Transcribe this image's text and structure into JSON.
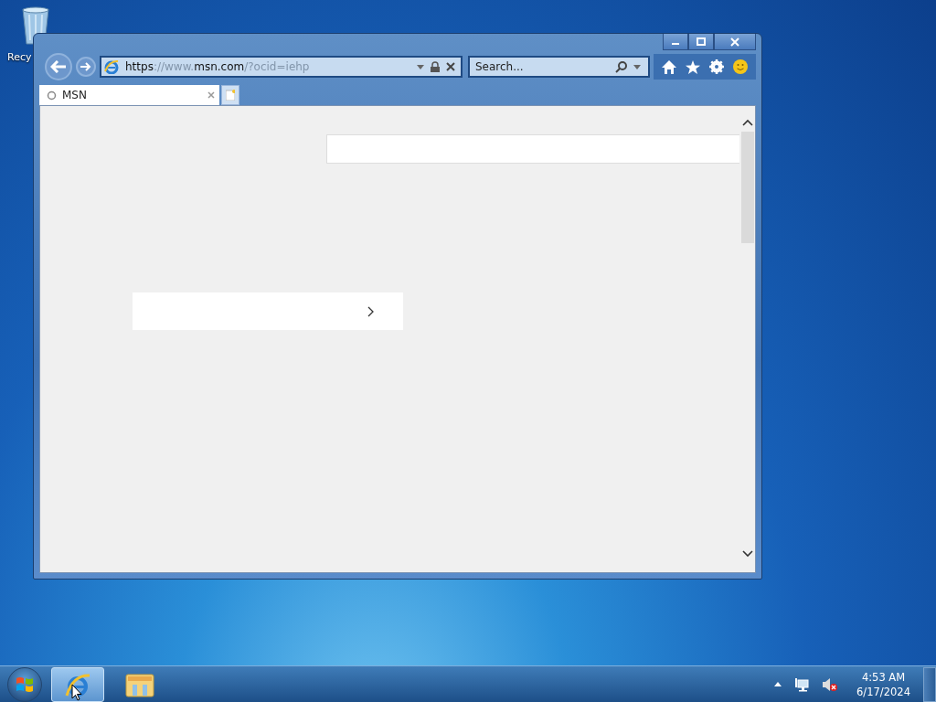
{
  "desktop_icons": [
    {
      "label": "Recy"
    }
  ],
  "window": {
    "title_buttons": [
      {
        "kind": "minimize"
      },
      {
        "kind": "maximize"
      },
      {
        "kind": "close"
      }
    ],
    "address": {
      "parts": [
        {
          "text": "https",
          "strong": true
        },
        {
          "text": "://www.",
          "strong": false
        },
        {
          "text": "msn.com",
          "strong": true
        },
        {
          "text": "/?ocid=iehp",
          "strong": false
        }
      ]
    },
    "search": {
      "placeholder": "Search..."
    },
    "tabs": [
      {
        "label": "MSN",
        "selected": true
      }
    ],
    "page": {
      "kind": "loading"
    }
  },
  "taskbar": {
    "items": [
      {
        "kind": "browser",
        "selected": true
      },
      {
        "kind": "folder",
        "selected": false
      }
    ],
    "clock": {
      "time": "4:53 AM",
      "date": "6/17/2024"
    }
  }
}
